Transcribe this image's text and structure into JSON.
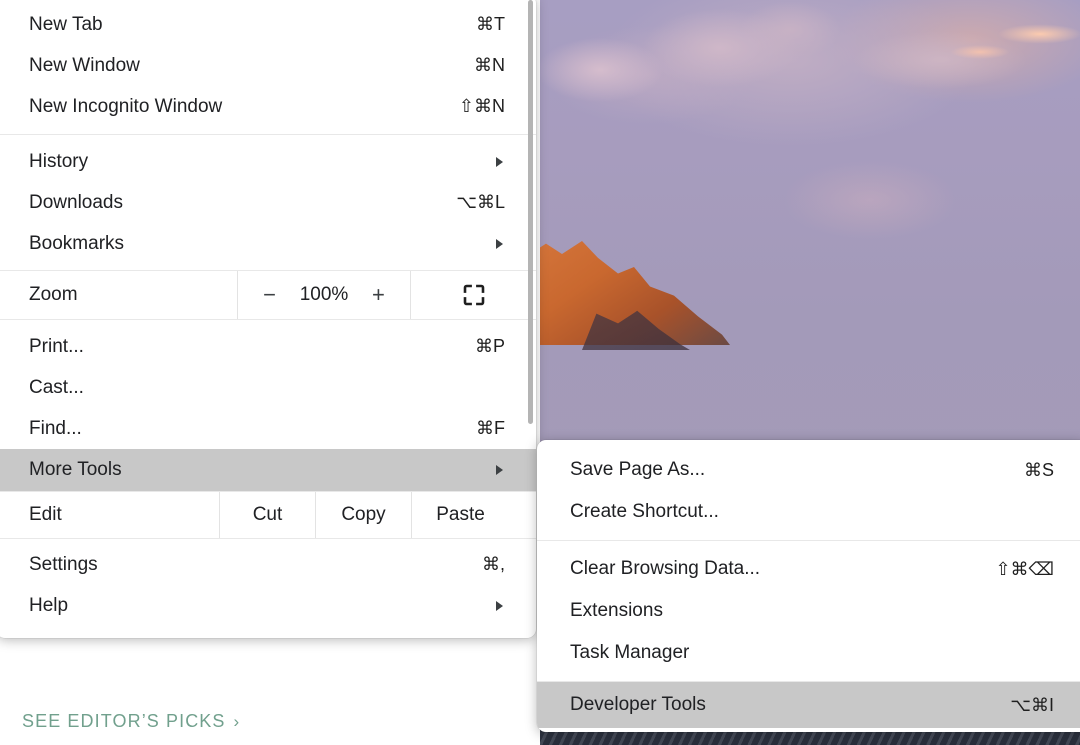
{
  "page": {
    "editors_picks_label": "SEE EDITOR’S PICKS",
    "editors_picks_chevron": "›",
    "link_color": "#71a08d"
  },
  "colors": {
    "highlight": "#c8c8c8",
    "text": "#202124",
    "separator": "#e8e8e8",
    "menu_background": "#ffffff"
  },
  "main_menu": {
    "sections": [
      {
        "items": [
          {
            "label": "New Tab",
            "accel": "⌘T",
            "type": "item"
          },
          {
            "label": "New Window",
            "accel": "⌘N",
            "type": "item"
          },
          {
            "label": "New Incognito Window",
            "accel": "⇧⌘N",
            "type": "item"
          }
        ]
      },
      {
        "items": [
          {
            "label": "History",
            "accel": "",
            "type": "submenu"
          },
          {
            "label": "Downloads",
            "accel": "⌥⌘L",
            "type": "item"
          },
          {
            "label": "Bookmarks",
            "accel": "",
            "type": "submenu"
          }
        ]
      },
      {
        "items": [
          {
            "label": "Zoom",
            "type": "zoom",
            "zoom_out_label": "−",
            "zoom_value": "100%",
            "zoom_in_label": "+",
            "fullscreen_icon": "fullscreen-icon"
          }
        ]
      },
      {
        "items": [
          {
            "label": "Print...",
            "accel": "⌘P",
            "type": "item"
          },
          {
            "label": "Cast...",
            "accel": "",
            "type": "item"
          },
          {
            "label": "Find...",
            "accel": "⌘F",
            "type": "item"
          },
          {
            "label": "More Tools",
            "accel": "",
            "type": "submenu",
            "selected": true
          }
        ]
      },
      {
        "items": [
          {
            "label": "Edit",
            "type": "edit",
            "actions": [
              "Cut",
              "Copy",
              "Paste"
            ]
          }
        ]
      },
      {
        "items": [
          {
            "label": "Settings",
            "accel": "⌘,",
            "type": "item"
          },
          {
            "label": "Help",
            "accel": "",
            "type": "submenu"
          }
        ]
      }
    ]
  },
  "sub_menu": {
    "sections": [
      {
        "items": [
          {
            "label": "Save Page As...",
            "accel": "⌘S",
            "type": "item"
          },
          {
            "label": "Create Shortcut...",
            "accel": "",
            "type": "item"
          }
        ]
      },
      {
        "items": [
          {
            "label": "Clear Browsing Data...",
            "accel": "⇧⌘⌫",
            "type": "item"
          },
          {
            "label": "Extensions",
            "accel": "",
            "type": "item"
          },
          {
            "label": "Task Manager",
            "accel": "",
            "type": "item"
          }
        ]
      },
      {
        "items": [
          {
            "label": "Developer Tools",
            "accel": "⌥⌘I",
            "type": "item",
            "selected": true
          }
        ]
      }
    ]
  }
}
